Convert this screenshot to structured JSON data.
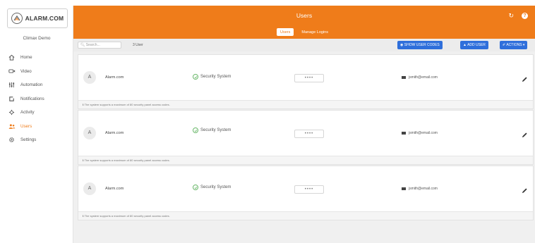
{
  "sidebar": {
    "logo_text": "ALARM.COM",
    "account_name": "Climax Demo",
    "items": [
      {
        "label": "Home",
        "icon": "home-icon",
        "active": false
      },
      {
        "label": "Video",
        "icon": "video-camera-icon",
        "active": false
      },
      {
        "label": "Automation",
        "icon": "automation-icon",
        "active": false
      },
      {
        "label": "Notifications",
        "icon": "notifications-icon",
        "active": false
      },
      {
        "label": "Activity",
        "icon": "activity-icon",
        "active": false
      },
      {
        "label": "Users",
        "icon": "users-icon",
        "active": true
      },
      {
        "label": "Settings",
        "icon": "gear-icon",
        "active": false
      }
    ]
  },
  "header": {
    "title": "Users",
    "tabs": [
      {
        "label": "Users",
        "active": true
      },
      {
        "label": "Manage Logins",
        "active": false
      }
    ]
  },
  "toolbar": {
    "search_placeholder": "Search...",
    "user_count": "3 User",
    "show_codes_label": "SHOW USER CODES",
    "add_user_label": "ADD USER",
    "actions_label": "ACTIONS"
  },
  "users": [
    {
      "initial": "A",
      "name": "Alarm.com",
      "system": "Security System",
      "code": "••••",
      "email": "jsmith@email.com",
      "note": "The system supports a maximum of 80 security panel access codes."
    },
    {
      "initial": "A",
      "name": "Alarm.com",
      "system": "Security System",
      "code": "••••",
      "email": "jsmith@email.com",
      "note": "The system supports a maximum of 80 security panel access codes."
    },
    {
      "initial": "A",
      "name": "Alarm.com",
      "system": "Security System",
      "code": "••••",
      "email": "jsmith@email.com",
      "note": "The system supports a maximum of 80 security panel access codes."
    }
  ],
  "colors": {
    "brand_orange": "#ef7c1a",
    "button_blue": "#2f6fdb",
    "success_green": "#6bb86b"
  }
}
